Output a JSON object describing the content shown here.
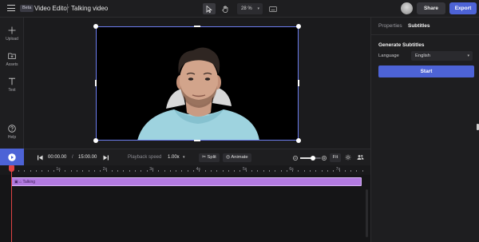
{
  "topbar": {
    "badge": "Beta",
    "app_title": "Video Editor",
    "doc_title": "Talking video",
    "zoom": "28 %",
    "share_label": "Share",
    "export_label": "Export"
  },
  "rail": {
    "items": [
      {
        "label": "Upload",
        "icon": "plus-icon"
      },
      {
        "label": "Assets",
        "icon": "folder-icon"
      },
      {
        "label": "Text",
        "icon": "text-icon"
      },
      {
        "label": "Help",
        "icon": "help-icon"
      }
    ]
  },
  "panel": {
    "tabs": [
      "Properties",
      "Subtitles"
    ],
    "active_tab": "Subtitles",
    "section_title": "Generate Subtitles",
    "language_label": "Language",
    "language_value": "English",
    "start_label": "Start"
  },
  "controls": {
    "current_time": "00:00.00",
    "separator": "/",
    "total_time": "15:00.00",
    "speed_label": "Playback speed",
    "speed_value": "1.00x",
    "split_label": "Split",
    "animate_label": "Animate",
    "fit_label": "Fit",
    "zoom_level": 0.62
  },
  "timeline": {
    "ticks": [
      "1s",
      "2s",
      "3s",
      "4s",
      "5s",
      "6s",
      "7s"
    ],
    "track_label": "Talking"
  },
  "colors": {
    "accent": "#4d63d6",
    "track": "#b27ae0",
    "playhead": "#e04343"
  }
}
